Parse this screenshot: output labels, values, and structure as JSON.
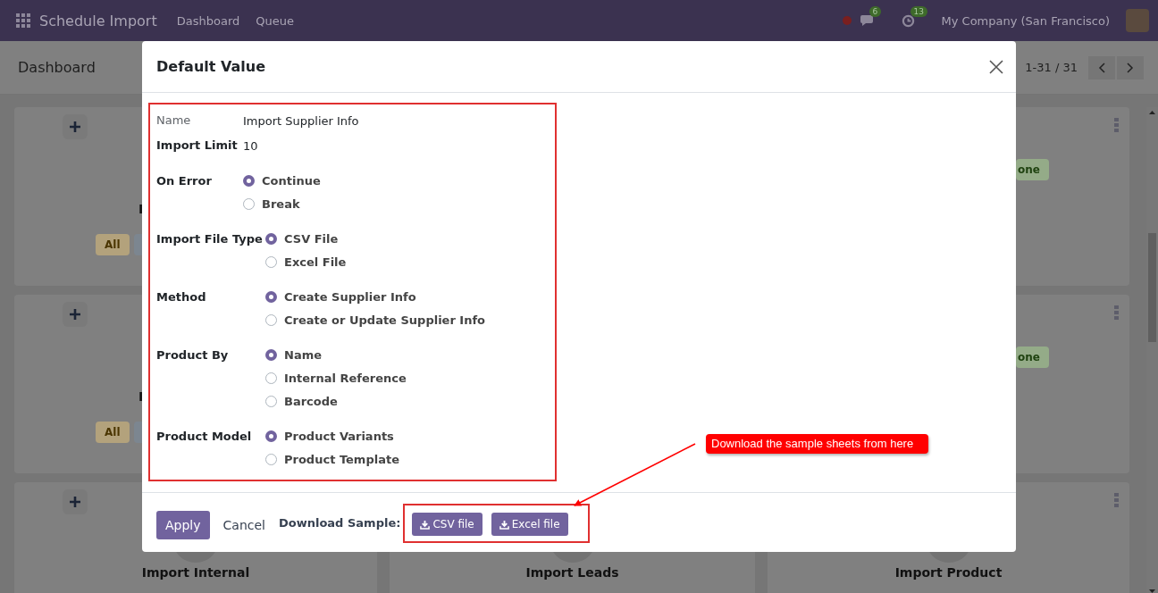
{
  "navbar": {
    "app_title": "Schedule Import",
    "menu": [
      "Dashboard",
      "Queue"
    ],
    "chat_count": "6",
    "activity_count": "13",
    "company": "My Company (San Francisco)"
  },
  "control_panel": {
    "title": "Dashboard",
    "pager": "1-31 / 31"
  },
  "card_columns": [
    {
      "cards": [
        {
          "title": "I",
          "badge": "All"
        },
        {
          "title": "I",
          "badge": "All"
        },
        {
          "title": "Import Internal"
        }
      ]
    },
    {
      "cards": [
        {
          "title": "Import Leads"
        }
      ]
    },
    {
      "cards": [
        {
          "badge": "one"
        },
        {
          "badge": "one"
        },
        {
          "title": "Import Product"
        }
      ]
    }
  ],
  "dialog": {
    "title": "Default Value",
    "groups": [
      {
        "fields": [
          {
            "kind": "text",
            "label": "Name",
            "required": false,
            "value": "Import Supplier Info"
          },
          {
            "kind": "text",
            "label": "Import Limit",
            "required": true,
            "value": "10"
          },
          {
            "kind": "radio",
            "label": "On Error",
            "required": true,
            "options": [
              {
                "label": "Continue",
                "selected": true
              },
              {
                "label": "Break",
                "selected": false
              }
            ]
          }
        ]
      },
      {
        "fields": [
          {
            "kind": "radio",
            "label": "Import File Type",
            "required": true,
            "options": [
              {
                "label": "CSV File",
                "selected": true
              },
              {
                "label": "Excel File",
                "selected": false
              }
            ]
          },
          {
            "kind": "radio",
            "label": "Method",
            "required": true,
            "options": [
              {
                "label": "Create Supplier Info",
                "selected": true
              },
              {
                "label": "Create or Update Supplier Info",
                "selected": false
              }
            ]
          },
          {
            "kind": "radio",
            "label": "Product By",
            "required": true,
            "options": [
              {
                "label": "Name",
                "selected": true
              },
              {
                "label": "Internal Reference",
                "selected": false
              },
              {
                "label": "Barcode",
                "selected": false
              }
            ]
          },
          {
            "kind": "radio",
            "label": "Product Model",
            "required": true,
            "options": [
              {
                "label": "Product Variants",
                "selected": true
              },
              {
                "label": "Product Template",
                "selected": false
              }
            ]
          }
        ]
      }
    ],
    "footer": {
      "apply": "Apply",
      "cancel": "Cancel",
      "download_label": "Download Sample:",
      "download_buttons": [
        "CSV file",
        "Excel file"
      ]
    }
  },
  "annotation": {
    "text": "Download the sample sheets from here"
  }
}
